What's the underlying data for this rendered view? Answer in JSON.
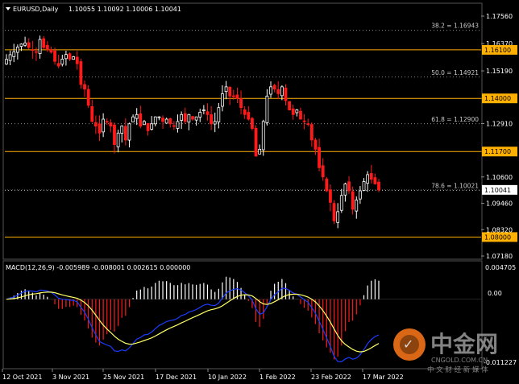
{
  "header": {
    "symbol": "EURUSD,Daily",
    "ohlc": "1.10055 1.10092 1.10006 1.10041"
  },
  "macd": {
    "label": "MACD(12,26,9) -0.005989 -0.008001 0.002615 0.000000",
    "axis_top": "0.004705",
    "axis_zero": "0.00",
    "axis_bottom": "-0.011227"
  },
  "price_axis": [
    "1.17560",
    "1.16370",
    "1.15190",
    "1.14000",
    "1.12910",
    "1.11700",
    "1.10600",
    "1.09460",
    "1.08320",
    "1.07180"
  ],
  "h_lines": [
    {
      "value": 1.161,
      "label": "1.16100",
      "color": "#ffb000"
    },
    {
      "value": 1.14,
      "label": "1.14000",
      "color": "#ffb000"
    },
    {
      "value": 1.117,
      "label": "1.11700",
      "color": "#ffb000"
    },
    {
      "value": 1.08,
      "label": "1.08000",
      "color": "#ffb000"
    }
  ],
  "fib_levels": [
    {
      "value": 1.16943,
      "label": "38.2 = 1.16943"
    },
    {
      "value": 1.14921,
      "label": "50.0 = 1.14921"
    },
    {
      "value": 1.129,
      "label": "61.8 = 1.12900"
    },
    {
      "value": 1.10021,
      "label": "78.6 = 1.10021"
    }
  ],
  "current_price": {
    "value": 1.10041,
    "label": "1.10041"
  },
  "x_axis": [
    "12 Oct 2021",
    "3 Nov 2021",
    "25 Nov 2021",
    "17 Dec 2021",
    "10 Jan 2022",
    "1 Feb 2022",
    "23 Feb 2022",
    "17 Mar 2022"
  ],
  "watermark": {
    "brand": "中金网",
    "domain": "CNGOLD.COM.CN",
    "tagline": "中 文 财 经 新 媒 体"
  },
  "colors": {
    "up_candle": "#ffffff",
    "down_candle": "#ff1a1a",
    "h_line": "#ffb000",
    "macd_up": "#ffffff",
    "macd_down": "#ff1a1a",
    "signal": "#ffff66",
    "macd_line": "#1a3cff"
  },
  "chart_data": {
    "type": "candlestick",
    "title": "EURUSD,Daily",
    "ylim": [
      1.0718,
      1.1756
    ],
    "closes": [
      1.1569,
      1.1589,
      1.1601,
      1.1622,
      1.1635,
      1.164,
      1.162,
      1.161,
      1.16,
      1.1655,
      1.162,
      1.161,
      1.16,
      1.156,
      1.154,
      1.157,
      1.159,
      1.157,
      1.158,
      1.155,
      1.146,
      1.144,
      1.137,
      1.13,
      1.128,
      1.125,
      1.131,
      1.13,
      1.128,
      1.12,
      1.125,
      1.128,
      1.122,
      1.129,
      1.132,
      1.133,
      1.128,
      1.13,
      1.126,
      1.129,
      1.132,
      1.132,
      1.13,
      1.131,
      1.129,
      1.128,
      1.13,
      1.133,
      1.13,
      1.133,
      1.131,
      1.132,
      1.134,
      1.135,
      1.133,
      1.129,
      1.13,
      1.136,
      1.142,
      1.145,
      1.141,
      1.141,
      1.14,
      1.136,
      1.133,
      1.131,
      1.127,
      1.115,
      1.118,
      1.13,
      1.141,
      1.145,
      1.144,
      1.142,
      1.145,
      1.139,
      1.135,
      1.133,
      1.135,
      1.131,
      1.13,
      1.129,
      1.122,
      1.118,
      1.11,
      1.106,
      1.1,
      1.095,
      1.087,
      1.091,
      1.098,
      1.103,
      1.1,
      1.092,
      1.096,
      1.1,
      1.104,
      1.107,
      1.105,
      1.103,
      1.1004
    ]
  }
}
